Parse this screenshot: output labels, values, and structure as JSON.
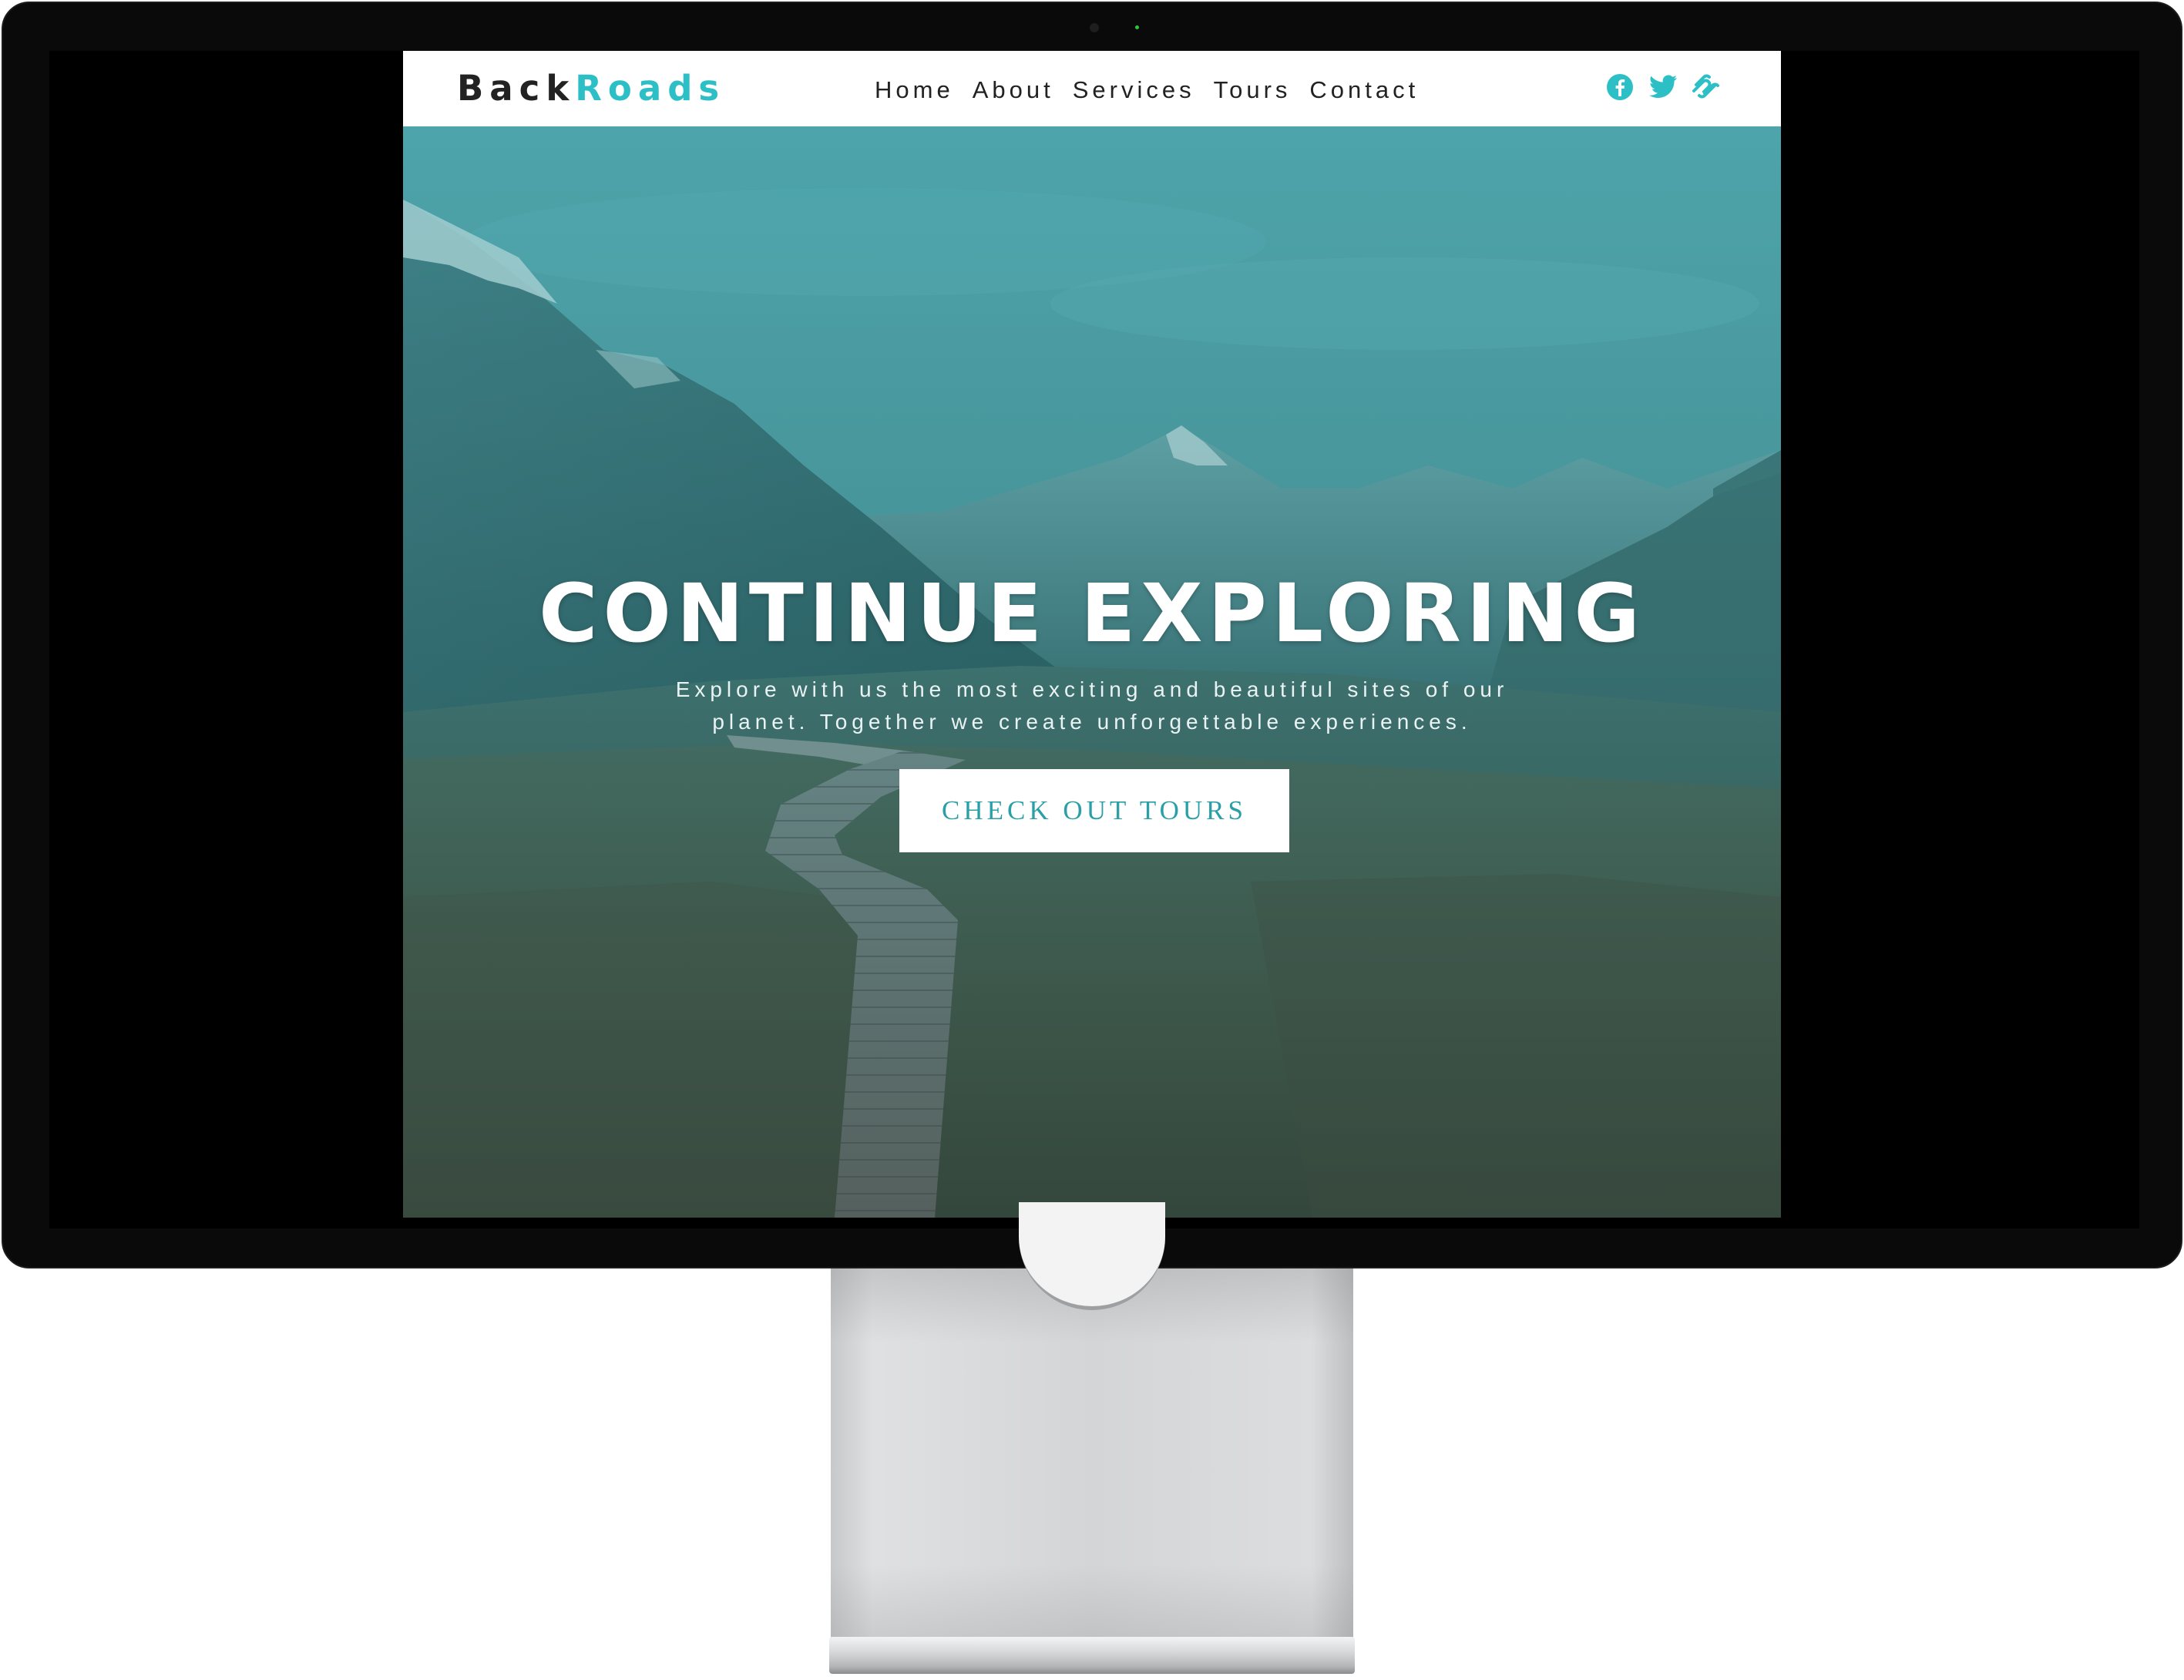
{
  "navbar": {
    "logo_part1": "Back",
    "logo_part2": "Roads",
    "links": [
      "Home",
      "About",
      "Services",
      "Tours",
      "Contact"
    ],
    "social_icons": [
      "facebook-icon",
      "twitter-icon",
      "squarespace-icon"
    ]
  },
  "hero": {
    "title": "CONTINUE EXPLORING",
    "text": "Explore with us the most exciting and beautiful sites of our planet. Together we create unforgettable experiences.",
    "button_label": "CHECK OUT TOURS"
  },
  "colors": {
    "accent": "#2cbfc6",
    "dark_text": "#222222",
    "button_text": "#2a9fa6",
    "hero_overlay": "#3ca0a8"
  }
}
